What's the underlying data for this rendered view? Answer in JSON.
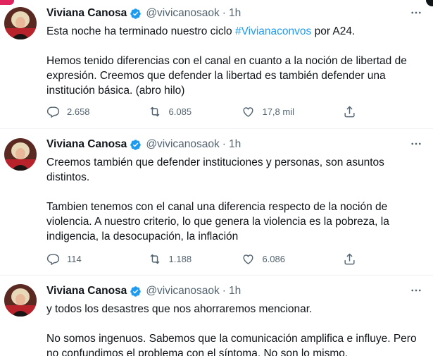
{
  "tweets": [
    {
      "author": "Viviana Canosa",
      "handle": "@vivicanosaok",
      "separator": "·",
      "time": "1h",
      "text_before_hashtag": "Esta noche ha terminado nuestro ciclo ",
      "hashtag": "#Vivianaconvos",
      "text_after_hashtag": " por A24.",
      "paragraph2": "Hemos tenido diferencias con el canal en cuanto a la noción de libertad de expresión. Creemos que defender la libertad es también defender una institución básica. (abro hilo)",
      "replies": "2.658",
      "retweets": "6.085",
      "likes": "17,8 mil"
    },
    {
      "author": "Viviana Canosa",
      "handle": "@vivicanosaok",
      "separator": "·",
      "time": "1h",
      "paragraph1": "Creemos también que defender instituciones y  personas, son asuntos distintos.",
      "paragraph2": "Tambien tenemos con el canal una diferencia respecto de la noción de violencia. A nuestro criterio, lo que genera la violencia es la pobreza, la indigencia, la desocupación, la inflación",
      "replies": "114",
      "retweets": "1.188",
      "likes": "6.086"
    },
    {
      "author": "Viviana Canosa",
      "handle": "@vivicanosaok",
      "separator": "·",
      "time": "1h",
      "paragraph1": "y todos los desastres que nos ahorraremos mencionar.",
      "paragraph2": "No somos ingenuos. Sabemos que la comunicación amplifica e influye. Pero no confundimos el problema con el síntoma. No son lo mismo."
    }
  ],
  "icons": {
    "verified": "verified-badge-icon",
    "more": "more-dots-icon",
    "reply": "reply-icon",
    "retweet": "retweet-icon",
    "like": "heart-icon",
    "share": "share-icon"
  },
  "colors": {
    "accent": "#1d9bf0",
    "text": "#0f1419",
    "muted": "#536471"
  }
}
